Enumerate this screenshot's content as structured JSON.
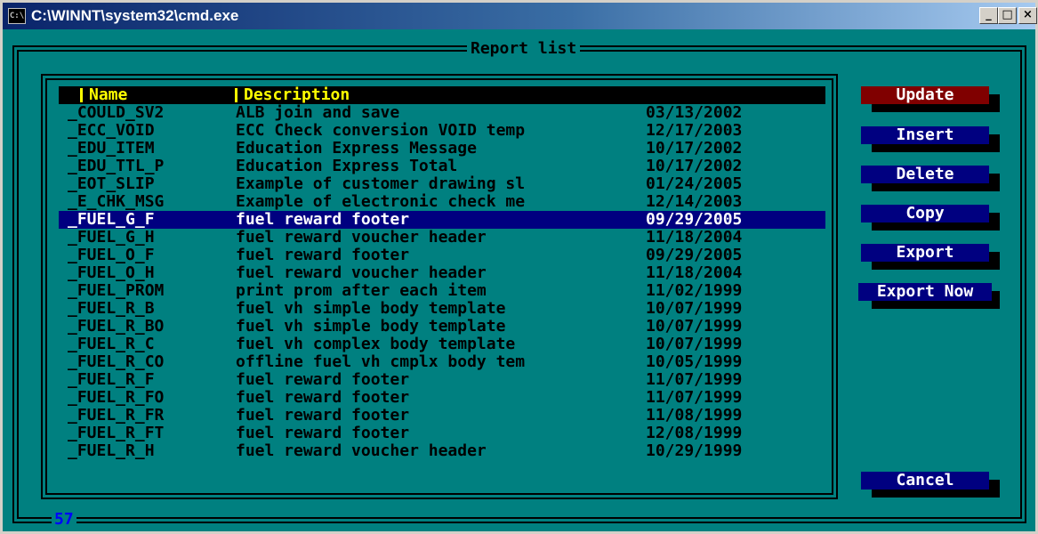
{
  "window": {
    "title": "C:\\WINNT\\system32\\cmd.exe",
    "icon": "console-icon",
    "controls": {
      "minimize": "_",
      "maximize": "□",
      "close": "×"
    }
  },
  "dialog": {
    "caption": "Report list",
    "counter": "57"
  },
  "list": {
    "columns": {
      "name": "Name",
      "description": "Description"
    },
    "rows": [
      {
        "name": "_COULD_SV2",
        "description": "ALB join and save",
        "date": "03/13/2002"
      },
      {
        "name": "_ECC_VOID",
        "description": "ECC Check conversion VOID temp",
        "date": "12/17/2003"
      },
      {
        "name": "_EDU_ITEM",
        "description": "Education Express Message",
        "date": "10/17/2002"
      },
      {
        "name": "_EDU_TTL_P",
        "description": "Education Express Total",
        "date": "10/17/2002"
      },
      {
        "name": "_EOT_SLIP",
        "description": "Example of customer drawing sl",
        "date": "01/24/2005"
      },
      {
        "name": "_E_CHK_MSG",
        "description": "Example of electronic check me",
        "date": "12/14/2003"
      },
      {
        "name": "_FUEL_G_F",
        "description": "fuel reward footer",
        "date": "09/29/2005"
      },
      {
        "name": "_FUEL_G_H",
        "description": "fuel reward voucher header",
        "date": "11/18/2004"
      },
      {
        "name": "_FUEL_O_F",
        "description": "fuel reward footer",
        "date": "09/29/2005"
      },
      {
        "name": "_FUEL_O_H",
        "description": "fuel reward voucher header",
        "date": "11/18/2004"
      },
      {
        "name": "_FUEL_PROM",
        "description": "print prom after each item",
        "date": "11/02/1999"
      },
      {
        "name": "_FUEL_R_B",
        "description": "fuel vh simple body template",
        "date": "10/07/1999"
      },
      {
        "name": "_FUEL_R_BO",
        "description": "fuel vh simple body template",
        "date": "10/07/1999"
      },
      {
        "name": "_FUEL_R_C",
        "description": "fuel vh complex body template",
        "date": "10/07/1999"
      },
      {
        "name": "_FUEL_R_CO",
        "description": "offline fuel vh cmplx body tem",
        "date": "10/05/1999"
      },
      {
        "name": "_FUEL_R_F",
        "description": "fuel reward footer",
        "date": "11/07/1999"
      },
      {
        "name": "_FUEL_R_FO",
        "description": "fuel reward footer",
        "date": "11/07/1999"
      },
      {
        "name": "_FUEL_R_FR",
        "description": "fuel reward footer",
        "date": "11/08/1999"
      },
      {
        "name": "_FUEL_R_FT",
        "description": "fuel reward footer",
        "date": "12/08/1999"
      },
      {
        "name": "_FUEL_R_H",
        "description": "fuel reward voucher header",
        "date": "10/29/1999"
      }
    ]
  },
  "buttons": {
    "update": "Update",
    "insert": "Insert",
    "delete": "Delete",
    "copy": "Copy",
    "export": "Export",
    "export_now": "Export Now",
    "cancel": "Cancel"
  },
  "colors": {
    "console_bg": "#008080",
    "header_text": "#ffff00",
    "selected_row_bg": "#000080",
    "button_face": "#000080",
    "active_button_face": "#800000",
    "counter_text": "#0000ff"
  }
}
